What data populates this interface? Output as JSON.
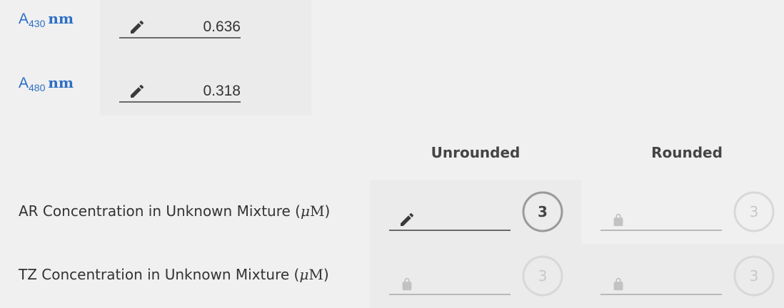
{
  "absorbance": [
    {
      "prefix": "A",
      "sub": "430",
      "unit": "nm",
      "value": "0.636",
      "icon": "pencil-icon"
    },
    {
      "prefix": "A",
      "sub": "480",
      "unit": "nm",
      "value": "0.318",
      "icon": "pencil-icon"
    }
  ],
  "table": {
    "col_unrounded": "Unrounded",
    "col_rounded": "Rounded",
    "rows": [
      {
        "label_prefix": "AR Concentration in Unknown Mixture (",
        "label_mu": "μ",
        "label_unit": "M",
        "label_suffix": ")",
        "unrounded": {
          "icon": "pencil-icon",
          "value": "",
          "sigfigs": "3"
        },
        "rounded": {
          "icon": "lock-icon",
          "value": "",
          "sigfigs": "3"
        }
      },
      {
        "label_prefix": "TZ Concentration in Unknown Mixture (",
        "label_mu": "μ",
        "label_unit": "M",
        "label_suffix": ")",
        "unrounded": {
          "icon": "lock-icon",
          "value": "",
          "sigfigs": "3"
        },
        "rounded": {
          "icon": "lock-icon",
          "value": "",
          "sigfigs": "3"
        }
      }
    ]
  },
  "colors": {
    "page_bg": "#f0f0f0",
    "cell_bg": "#ebebeb",
    "label_blue": "#2c6fc4",
    "active_ring": "#9a9a9a",
    "inactive_ring": "#d8d8d8"
  }
}
